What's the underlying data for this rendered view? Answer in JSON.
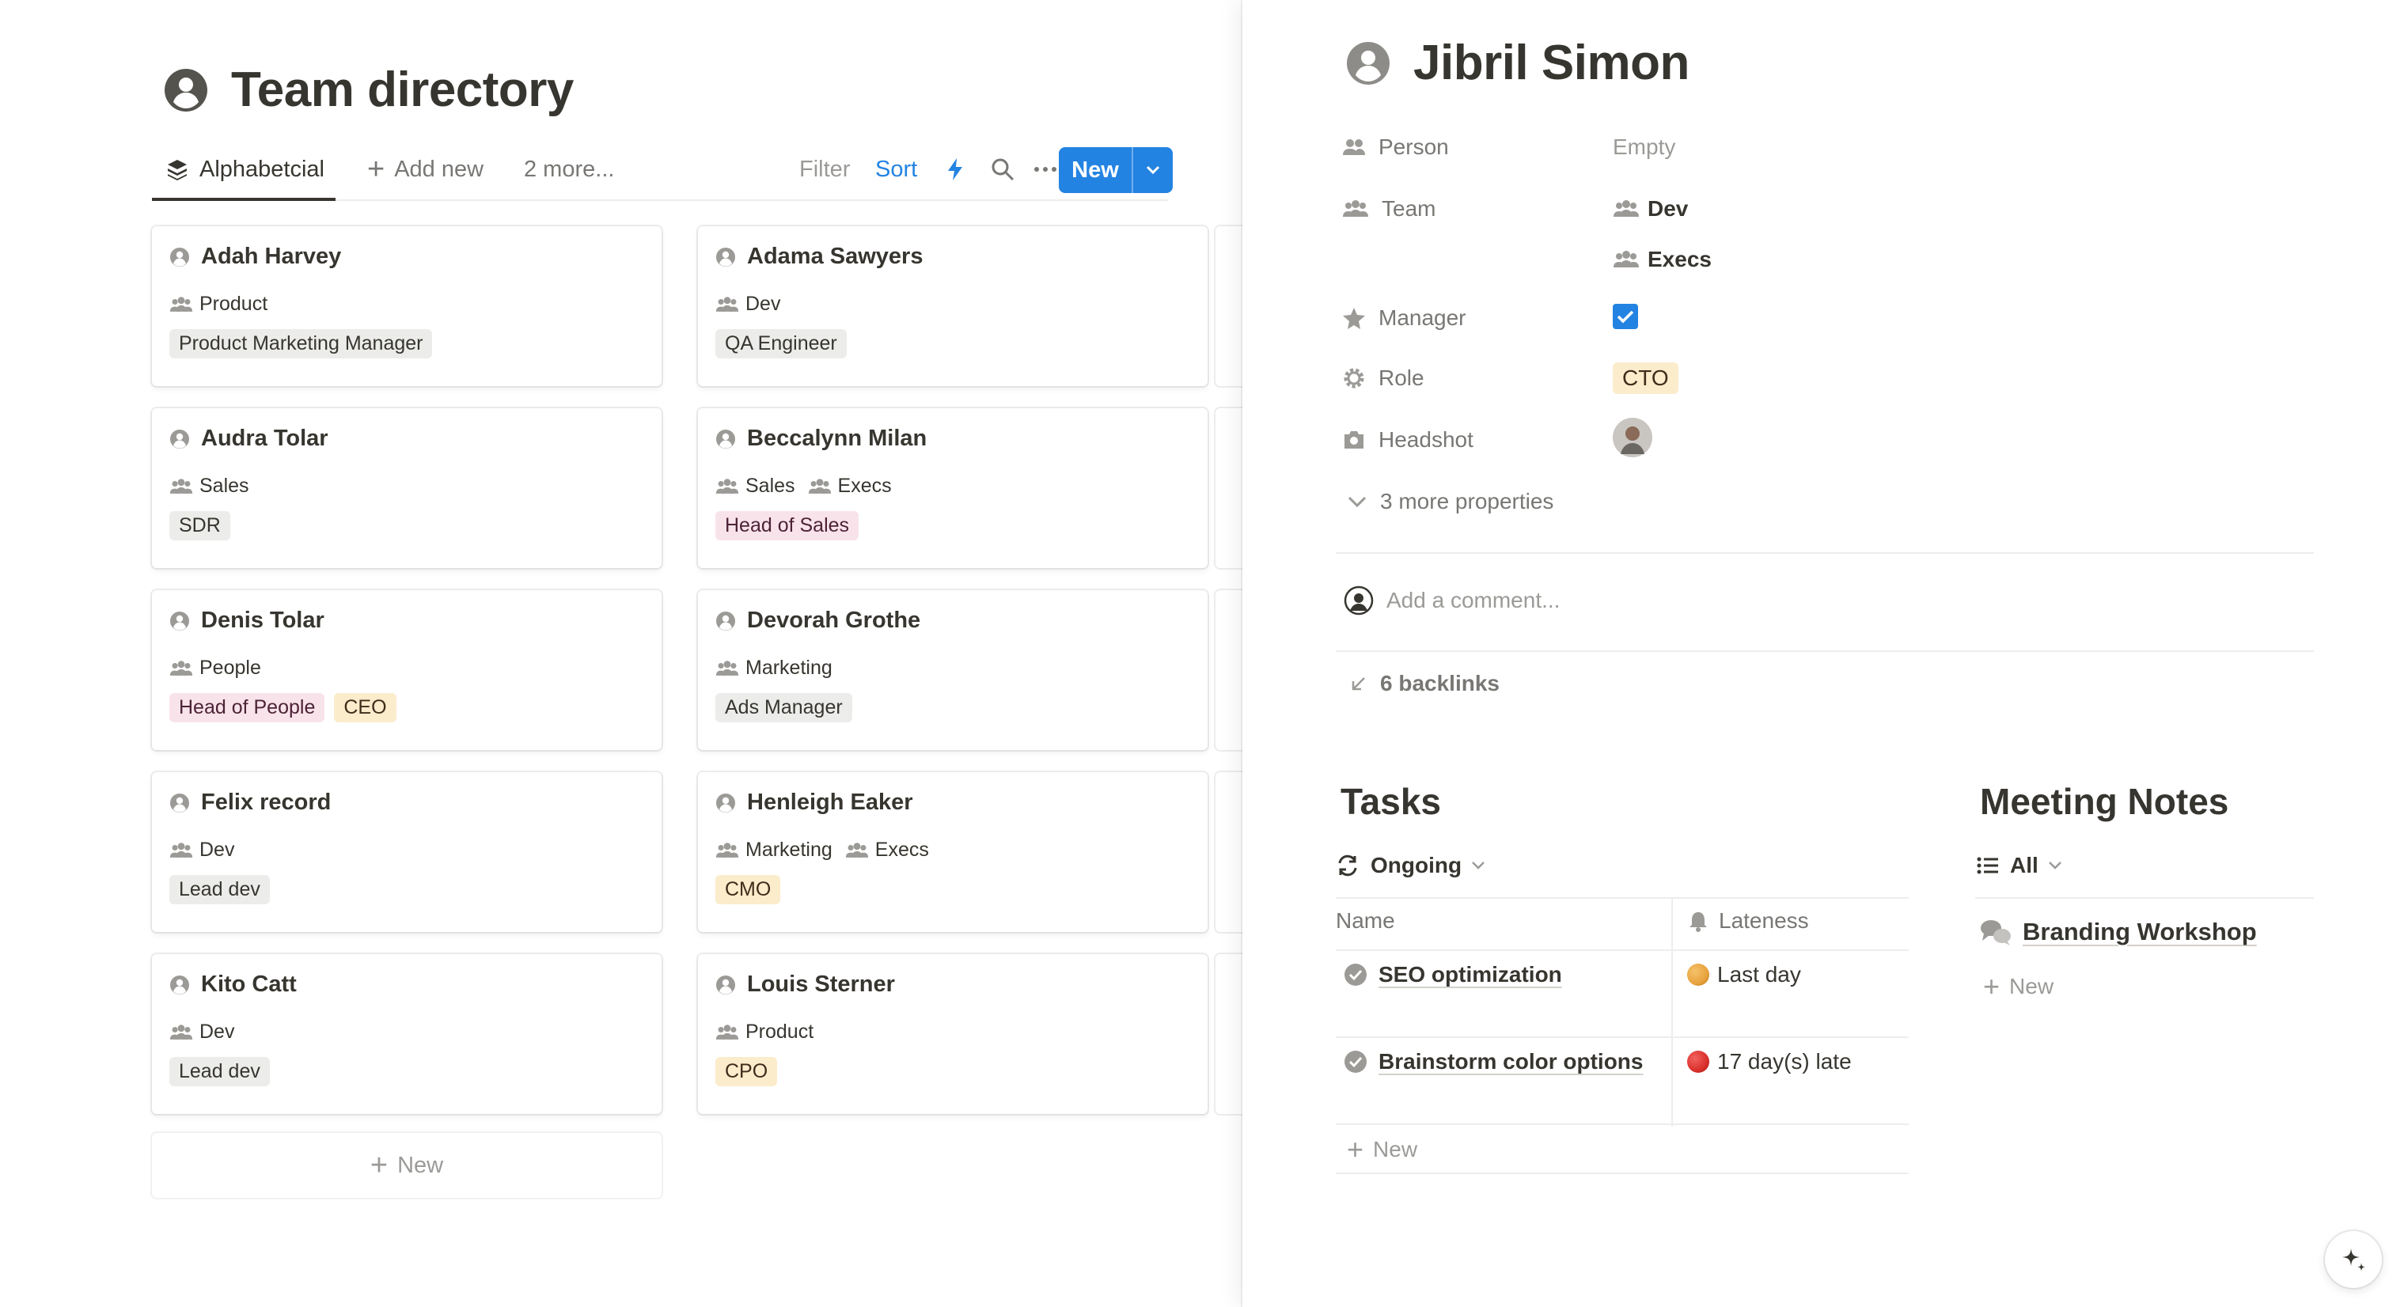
{
  "board": {
    "title": "Team directory",
    "views": {
      "active_tab": "Alphabetcial",
      "add_new": "Add new",
      "more": "2 more...",
      "filter": "Filter",
      "sort": "Sort",
      "new_button": "New"
    },
    "cards": [
      {
        "name": "Adah Harvey",
        "teams": [
          "Product"
        ],
        "tags": [
          {
            "text": "Product Marketing Manager",
            "color": "gray"
          }
        ]
      },
      {
        "name": "Adama Sawyers",
        "teams": [
          "Dev"
        ],
        "tags": [
          {
            "text": "QA Engineer",
            "color": "gray"
          }
        ]
      },
      {
        "name": "Audra Tolar",
        "teams": [
          "Sales"
        ],
        "tags": [
          {
            "text": "SDR",
            "color": "gray"
          }
        ]
      },
      {
        "name": "Beccalynn Milan",
        "teams": [
          "Sales",
          "Execs"
        ],
        "tags": [
          {
            "text": "Head of Sales",
            "color": "pink"
          }
        ]
      },
      {
        "name": "Denis Tolar",
        "teams": [
          "People"
        ],
        "tags": [
          {
            "text": "Head of People",
            "color": "pink"
          },
          {
            "text": "CEO",
            "color": "yellow"
          }
        ]
      },
      {
        "name": "Devorah Grothe",
        "teams": [
          "Marketing"
        ],
        "tags": [
          {
            "text": "Ads Manager",
            "color": "gray"
          }
        ]
      },
      {
        "name": "Felix record",
        "teams": [
          "Dev"
        ],
        "tags": [
          {
            "text": "Lead dev",
            "color": "gray"
          }
        ]
      },
      {
        "name": "Henleigh Eaker",
        "teams": [
          "Marketing",
          "Execs"
        ],
        "tags": [
          {
            "text": "CMO",
            "color": "yellow"
          }
        ]
      },
      {
        "name": "Kito Catt",
        "teams": [
          "Dev"
        ],
        "tags": [
          {
            "text": "Lead dev",
            "color": "gray"
          }
        ]
      },
      {
        "name": "Louis Sterner",
        "teams": [
          "Product"
        ],
        "tags": [
          {
            "text": "CPO",
            "color": "yellow"
          }
        ]
      }
    ],
    "new_card": "New"
  },
  "peek": {
    "title": "Jibril Simon",
    "props": {
      "person_label": "Person",
      "person_value": "Empty",
      "team_label": "Team",
      "team_values": [
        "Dev",
        "Execs"
      ],
      "manager_label": "Manager",
      "manager_checked": true,
      "role_label": "Role",
      "role_value": "CTO",
      "headshot_label": "Headshot",
      "more_props": "3 more properties"
    },
    "comment_placeholder": "Add a comment...",
    "backlinks": "6 backlinks",
    "tasks": {
      "title": "Tasks",
      "view": "Ongoing",
      "col_name": "Name",
      "col_lateness": "Lateness",
      "rows": [
        {
          "name": "SEO optimization",
          "lateness": "Last day",
          "dot_color": "#e8a33d"
        },
        {
          "name": "Brainstorm color options",
          "lateness": "17 day(s) late",
          "dot_color": "#d9302c"
        }
      ],
      "new": "New"
    },
    "meetings": {
      "title": "Meeting Notes",
      "view": "All",
      "items": [
        "Branding Workshop"
      ],
      "new": "New"
    }
  },
  "colors": {
    "accent": "#2383e2",
    "text": "#37352f",
    "muted": "#787774"
  }
}
